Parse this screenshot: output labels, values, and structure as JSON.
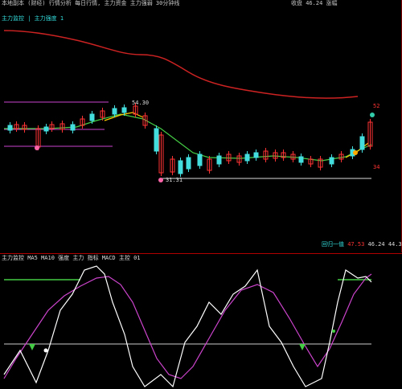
{
  "header": {
    "title_bar": "本地副本 (财经)  行情分析  每日行情, 主力资金  主力强弱  30分钟线",
    "right_info": "收盘 46.24  涨幅",
    "sub_title": "主力监控 | 主力强度 1"
  },
  "price_panel": {
    "high_label": "54.30",
    "low_label": "31.31",
    "right_top_label": "52",
    "right_low_label": "34",
    "info_box": {
      "prefix": "回归一值",
      "v1": "47.53",
      "v2": "46.24",
      "v3": "44.35"
    },
    "colors": {
      "upper_band": "#cc3333",
      "channel": "#cc44cc",
      "ma_short": "#ffcc00",
      "ma_long": "#44cc44",
      "up_candle": "#ff3333",
      "down_candle": "#44dddd"
    }
  },
  "osc_panel": {
    "title": "主力监控 MA5  MA10  强度  主力  指标  MACD  主控  01",
    "colors": {
      "fast_line": "#ffffff",
      "slow_line": "#cc44cc",
      "ref_line": "#cccccc",
      "top_line": "#44cc44"
    }
  }
}
